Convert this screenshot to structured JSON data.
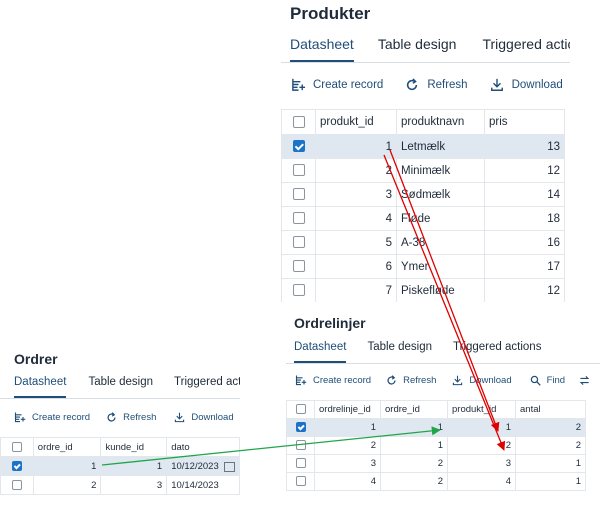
{
  "produkter": {
    "title": "Produkter",
    "tabs": [
      "Datasheet",
      "Table design",
      "Triggered actior"
    ],
    "toolbar": {
      "create": "Create record",
      "refresh": "Refresh",
      "download": "Download"
    },
    "columns": [
      "produkt_id",
      "produktnavn",
      "pris"
    ],
    "rows": [
      {
        "id": "1",
        "name": "Letmælk",
        "pris": "13",
        "selected": true
      },
      {
        "id": "2",
        "name": "Minimælk",
        "pris": "12",
        "selected": false
      },
      {
        "id": "3",
        "name": "Sødmælk",
        "pris": "14",
        "selected": false
      },
      {
        "id": "4",
        "name": "Fløde",
        "pris": "18",
        "selected": false
      },
      {
        "id": "5",
        "name": "A-38",
        "pris": "16",
        "selected": false
      },
      {
        "id": "6",
        "name": "Ymer",
        "pris": "17",
        "selected": false
      },
      {
        "id": "7",
        "name": "Piskefløde",
        "pris": "12",
        "selected": false
      }
    ]
  },
  "ordrelinjer": {
    "title": "Ordrelinjer",
    "tabs": [
      "Datasheet",
      "Table design",
      "Triggered actions"
    ],
    "toolbar": {
      "create": "Create record",
      "refresh": "Refresh",
      "download": "Download",
      "find": "Find"
    },
    "columns": [
      "ordrelinje_id",
      "ordre_id",
      "produkt_id",
      "antal"
    ],
    "rows": [
      {
        "cells": [
          "1",
          "1",
          "1",
          "2"
        ],
        "selected": true
      },
      {
        "cells": [
          "2",
          "1",
          "2",
          "2"
        ],
        "selected": false
      },
      {
        "cells": [
          "3",
          "2",
          "3",
          "1"
        ],
        "selected": false
      },
      {
        "cells": [
          "4",
          "2",
          "4",
          "1"
        ],
        "selected": false
      }
    ]
  },
  "ordrer": {
    "title": "Ordrer",
    "tabs": [
      "Datasheet",
      "Table design",
      "Triggered actior"
    ],
    "toolbar": {
      "create": "Create record",
      "refresh": "Refresh",
      "download": "Download"
    },
    "columns": [
      "ordre_id",
      "kunde_id",
      "dato"
    ],
    "rows": [
      {
        "cells": [
          "1",
          "1",
          "10/12/2023"
        ],
        "selected": true
      },
      {
        "cells": [
          "2",
          "3",
          "10/14/2023"
        ],
        "selected": false
      }
    ]
  },
  "colors": {
    "accent": "#1f4e79",
    "selection": "#dfe7f0",
    "checkbox": "#1a73c8",
    "arrow_red": "#e00000",
    "arrow_green": "#1fa64a"
  },
  "icons": {
    "create": "add-record-icon",
    "refresh": "refresh-icon",
    "download": "download-icon",
    "find": "search-icon",
    "calendar": "calendar-icon"
  }
}
